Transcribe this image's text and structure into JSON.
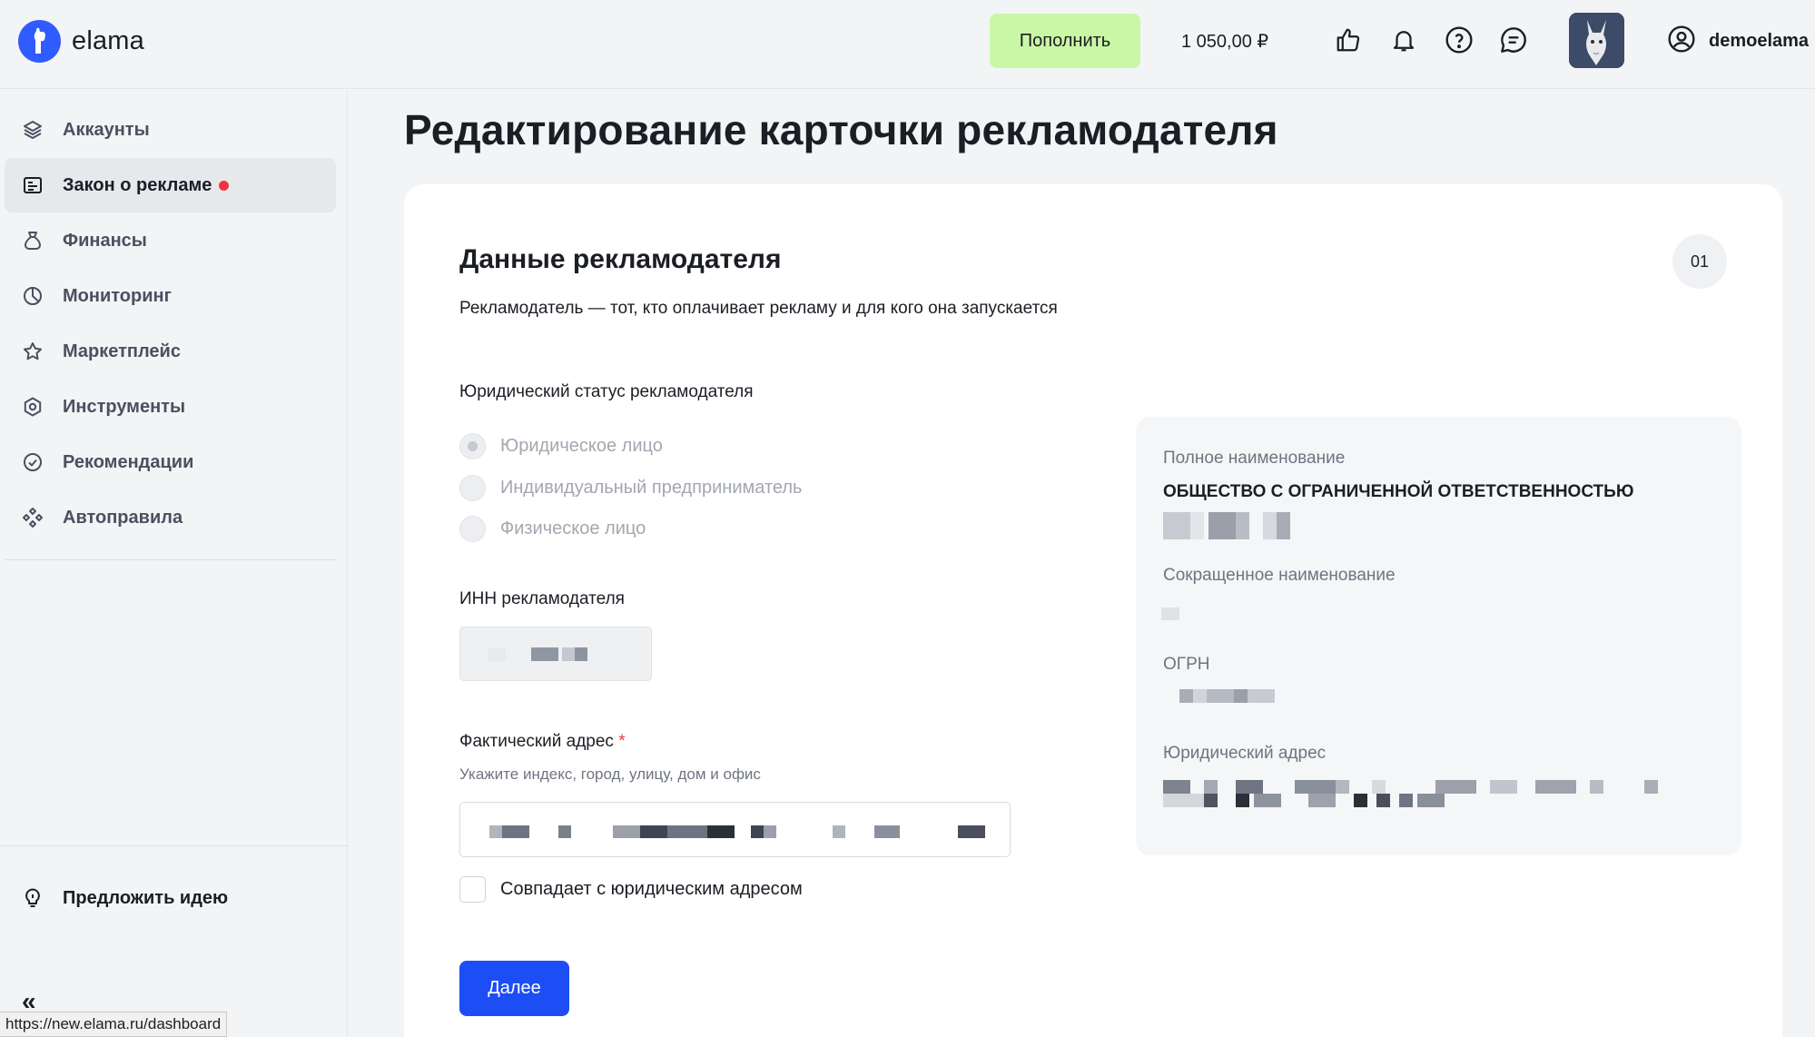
{
  "header": {
    "logo_text": "elama",
    "topup_label": "Пополнить",
    "balance": "1 050,00 ₽",
    "username": "demoelama",
    "icons": [
      "thumbs-up-icon",
      "bell-icon",
      "help-icon",
      "chat-icon",
      "user-circle-icon"
    ]
  },
  "sidebar": {
    "items": [
      {
        "label": "Аккаунты",
        "icon": "layers-icon"
      },
      {
        "label": "Закон о рекламе",
        "icon": "card-icon",
        "has_notification": true
      },
      {
        "label": "Финансы",
        "icon": "money-bag-icon"
      },
      {
        "label": "Мониторинг",
        "icon": "pie-chart-icon"
      },
      {
        "label": "Маркетплейс",
        "icon": "star-icon"
      },
      {
        "label": "Инструменты",
        "icon": "settings-icon"
      },
      {
        "label": "Рекомендации",
        "icon": "check-circle-icon"
      },
      {
        "label": "Автоправила",
        "icon": "diamond-grid-icon"
      }
    ],
    "suggest_label": "Предложить идею",
    "collapse_glyph": "«",
    "active_index": 1
  },
  "main": {
    "page_title": "Редактирование карточки рекламодателя",
    "section_title": "Данные рекламодателя",
    "step": "01",
    "section_desc": "Рекламодатель — тот, кто оплачивает рекламу и для кого она запускается",
    "legal_status_label": "Юридический статус рекламодателя",
    "legal_status_options": [
      "Юридическое лицо",
      "Индивидуальный предприниматель",
      "Физическое лицо"
    ],
    "legal_status_selected": 0,
    "inn_label": "ИНН рекламодателя",
    "address_label": "Фактический адрес",
    "address_required": "*",
    "address_hint": "Укажите индекс, город, улицу, дом и офис",
    "same_address_label": "Совпадает с юридическим адресом",
    "same_address_checked": false,
    "next_label": "Далее"
  },
  "info_panel": {
    "full_name_label": "Полное наименование",
    "full_name_value": "ОБЩЕСТВО С ОГРАНИЧЕННОЙ ОТВЕТСТВЕННОСТЬЮ",
    "short_name_label": "Сокращенное наименование",
    "ogrn_label": "ОГРН",
    "legal_address_label": "Юридический адрес"
  },
  "status_bar": {
    "url": "https://new.elama.ru/dashboard"
  },
  "colors": {
    "accent": "#1d4ef5",
    "topup": "#c9f7a6",
    "notification": "#f0353f",
    "logo": "#2f5bff"
  }
}
